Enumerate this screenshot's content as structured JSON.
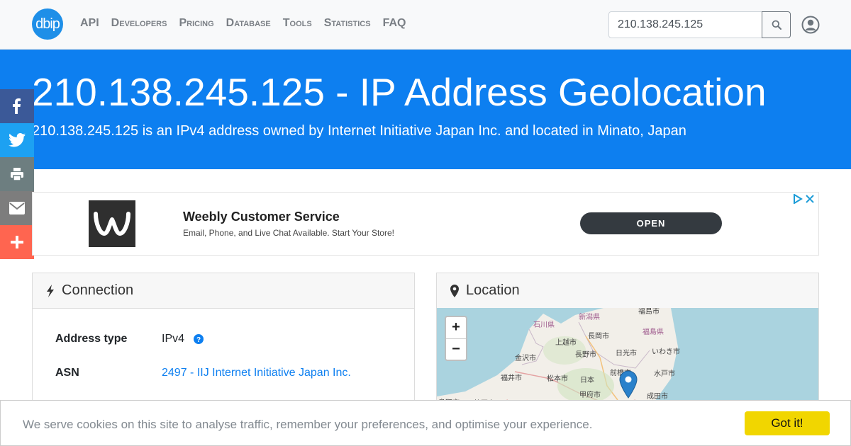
{
  "brand": {
    "logo_text": "dbip",
    "color": "#1e8fe8"
  },
  "nav": {
    "items": [
      {
        "label": "API"
      },
      {
        "label": "Developers"
      },
      {
        "label": "Pricing"
      },
      {
        "label": "Database"
      },
      {
        "label": "Tools"
      },
      {
        "label": "Statistics"
      },
      {
        "label": "FAQ"
      }
    ],
    "search_value": "210.138.245.125"
  },
  "hero": {
    "title": "210.138.245.125 - IP Address Geolocation",
    "subtitle": "210.138.245.125 is an IPv4 address owned by Internet Initiative Japan Inc. and located in Minato, Japan",
    "bg_color": "#0d7ff0"
  },
  "share": [
    {
      "icon": "facebook-icon",
      "color": "#3b5998"
    },
    {
      "icon": "twitter-icon",
      "color": "#1da1f2"
    },
    {
      "icon": "print-icon",
      "color": "#6d7e80"
    },
    {
      "icon": "email-icon",
      "color": "#7d7d7d"
    },
    {
      "icon": "plus-icon",
      "color": "#ff6550"
    }
  ],
  "ad": {
    "title": "Weebly Customer Service",
    "description": "Email, Phone, and Live Chat Available. Start Your Store!",
    "button": "OPEN"
  },
  "connection": {
    "header": "Connection",
    "rows": [
      {
        "label": "Address type",
        "value": "IPv4"
      },
      {
        "label": "ASN",
        "value": "2497 - IIJ Internet Initiative Japan Inc."
      }
    ]
  },
  "location": {
    "header": "Location",
    "zoom_in": "+",
    "zoom_out": "−",
    "map_labels": [
      "新潟県",
      "福島市",
      "石川県",
      "長岡市",
      "福島県",
      "上越市",
      "金沢市",
      "長野市",
      "日光市",
      "いわき市",
      "福井市",
      "松本市",
      "日本",
      "前橋市",
      "水戸市",
      "甲府市",
      "成田市",
      "鳥取市",
      "静岡市"
    ]
  },
  "cookie": {
    "text": "We serve cookies on this site to analyse traffic, remember your preferences, and optimise your experience.",
    "button": "Got it!"
  }
}
